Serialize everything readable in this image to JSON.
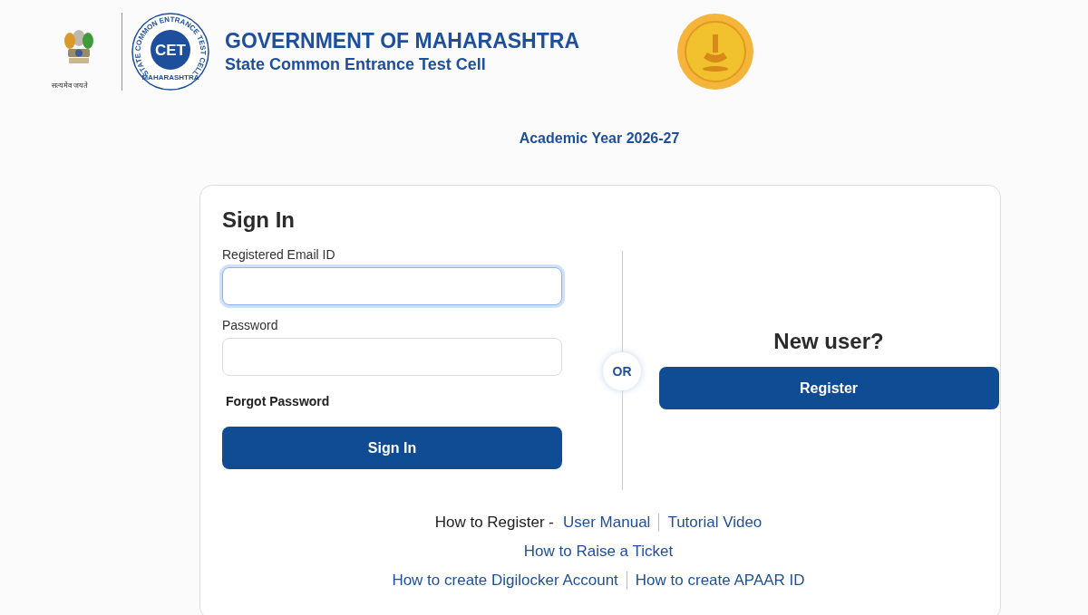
{
  "header": {
    "emblem_motto": "सत्यमेव जयते",
    "cet_logo": {
      "ring_text": "STATE COMMON ENTRANCE TEST CELL",
      "center_text": "CET",
      "bottom_text": "MAHARASHTRA"
    },
    "title": "GOVERNMENT OF MAHARASHTRA",
    "subtitle": "State Common Entrance Test Cell"
  },
  "academic_year": "Academic Year 2026-27",
  "sign_in": {
    "heading": "Sign In",
    "fields": [
      {
        "label": "Registered Email ID",
        "focused": true
      },
      {
        "label": "Password",
        "focused": false
      }
    ],
    "forgot_link": "Forgot Password",
    "button": "Sign In"
  },
  "divider_label": "OR",
  "new_user": {
    "heading": "New user?",
    "button": "Register"
  },
  "help_rows": [
    [
      {
        "kind": "text",
        "text": "How to Register -"
      },
      {
        "kind": "link",
        "text": "User Manual"
      },
      {
        "kind": "link",
        "text": "Tutorial Video"
      }
    ],
    [
      {
        "kind": "link",
        "text": "How to Raise a Ticket"
      }
    ],
    [
      {
        "kind": "link",
        "text": "How to create Digilocker Account"
      },
      {
        "kind": "link",
        "text": "How to create APAAR ID"
      }
    ]
  ]
}
